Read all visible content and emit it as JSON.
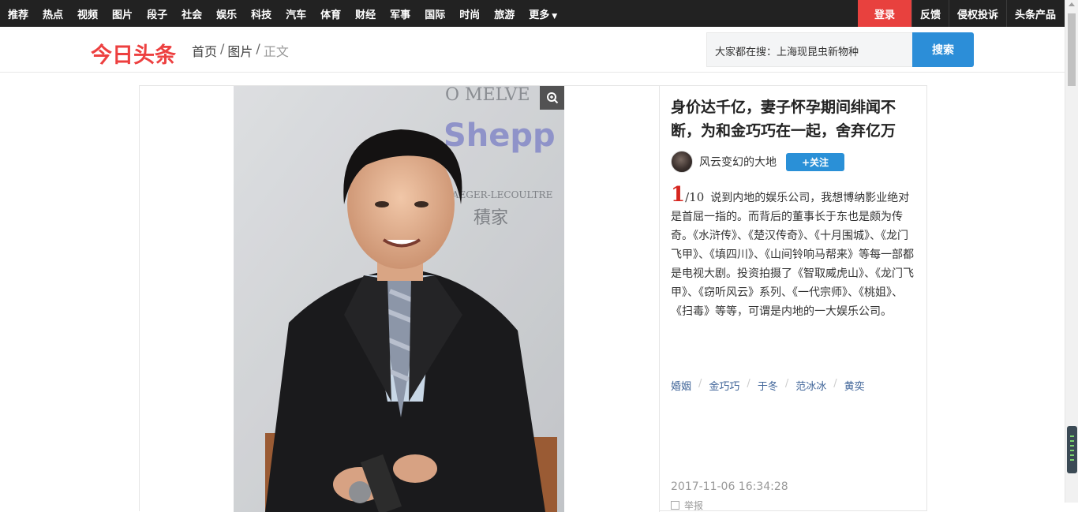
{
  "topnav": {
    "links": [
      "推荐",
      "热点",
      "视频",
      "图片",
      "段子",
      "社会",
      "娱乐",
      "科技",
      "汽车",
      "体育",
      "财经",
      "军事",
      "国际",
      "时尚",
      "旅游",
      "更多"
    ],
    "login": "登录",
    "feedback": "反馈",
    "report_infringement": "侵权投诉",
    "products": "头条产品"
  },
  "header": {
    "logo": "今日头条",
    "breadcrumb": {
      "home": "首页",
      "section": "图片",
      "current": "正文",
      "separator": "/"
    },
    "search": {
      "placeholder": "大家都在搜：上海现昆虫新物种",
      "button": "搜索"
    }
  },
  "article": {
    "title": "身价达千亿，妻子怀孕期间绯闻不断，为和金巧巧在一起，舍弃亿万",
    "author": "风云变幻的大地",
    "follow": "+关注",
    "page_current": "1",
    "page_total": "/10",
    "description": "说到内地的娱乐公司，我想博纳影业绝对是首屈一指的。而背后的董事长于东也是颇为传奇。《水浒传》、《楚汉传奇》、《十月围城》、《龙门飞甲》、《填四川》、《山间铃响马帮来》等每一部都是电视大剧。投资拍摄了《智取威虎山》、《龙门飞甲》、《窃听风云》系列、《一代宗师》、《桃姐》、《扫毒》等等，可谓是内地的一大娱乐公司。",
    "tags": [
      "婚姻",
      "金巧巧",
      "于冬",
      "范冰冰",
      "黄奕"
    ],
    "date": "2017-11-06 16:34:28",
    "report": "举报"
  },
  "photo": {
    "backdrop_text_1": "O MELVE",
    "backdrop_text_2": "Shepp",
    "backdrop_text_3": "JAEGER-LECOULTRE",
    "backdrop_text_4": "積家"
  },
  "colors": {
    "topnav_bg": "#222222",
    "login_bg": "#e8413e",
    "logo": "#ed4040",
    "search_button": "#2c8ed8",
    "follow_button": "#2a90d7",
    "tag_link": "#406599",
    "page_number": "#d6261f"
  }
}
